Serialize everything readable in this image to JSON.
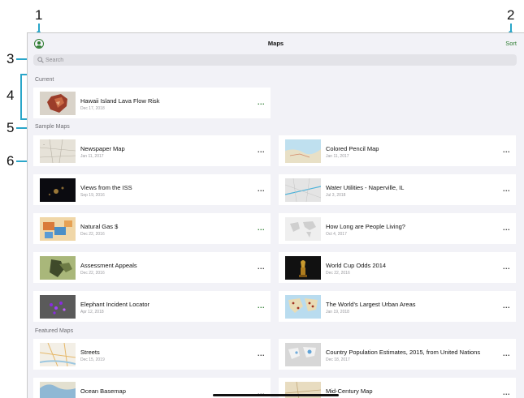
{
  "callouts": [
    "1",
    "2",
    "3",
    "4",
    "5",
    "6"
  ],
  "header": {
    "title": "Maps",
    "sort_label": "Sort",
    "profile_icon": "account-icon"
  },
  "search": {
    "placeholder": "Search",
    "icon": "search-icon"
  },
  "colors": {
    "accent": "#2e7d32",
    "callout_line": "#2aa6c9",
    "more_green": "#2e7d32",
    "more_dark": "#333333"
  },
  "sections": {
    "current": "Current",
    "sample": "Sample Maps",
    "featured": "Featured Maps"
  },
  "current_map": {
    "title": "Hawaii Island Lava Flow Risk",
    "date": "Dec 17, 2018",
    "more": "..."
  },
  "sample_maps": [
    {
      "title": "Newspaper Map",
      "date": "Jan 11, 2017",
      "more": "..."
    },
    {
      "title": "Colored Pencil Map",
      "date": "Jan 11, 2017",
      "more": "..."
    },
    {
      "title": "Views from the ISS",
      "date": "Sep 19, 2016",
      "more": "..."
    },
    {
      "title": "Water Utilities - Naperville, IL",
      "date": "Jul 3, 2018",
      "more": "..."
    },
    {
      "title": "Natural Gas $",
      "date": "Dec 22, 2016",
      "more": "..."
    },
    {
      "title": "How Long are People Living?",
      "date": "Oct 4, 2017",
      "more": "..."
    },
    {
      "title": "Assessment Appeals",
      "date": "Dec 22, 2016",
      "more": "..."
    },
    {
      "title": "World Cup Odds 2014",
      "date": "Dec 22, 2016",
      "more": "..."
    },
    {
      "title": "Elephant Incident Locator",
      "date": "Apr 12, 2018",
      "more": "..."
    },
    {
      "title": "The World's Largest Urban Areas",
      "date": "Jan 19, 2018",
      "more": "..."
    }
  ],
  "featured_maps": [
    {
      "title": "Streets",
      "date": "Dec 15, 2019",
      "more": "..."
    },
    {
      "title": "Country Population Estimates, 2015, from United Nations",
      "date": "Dec 18, 2017",
      "more": "..."
    },
    {
      "title": "Ocean Basemap",
      "date": "",
      "more": "..."
    },
    {
      "title": "Mid-Century Map",
      "date": "",
      "more": "..."
    }
  ]
}
